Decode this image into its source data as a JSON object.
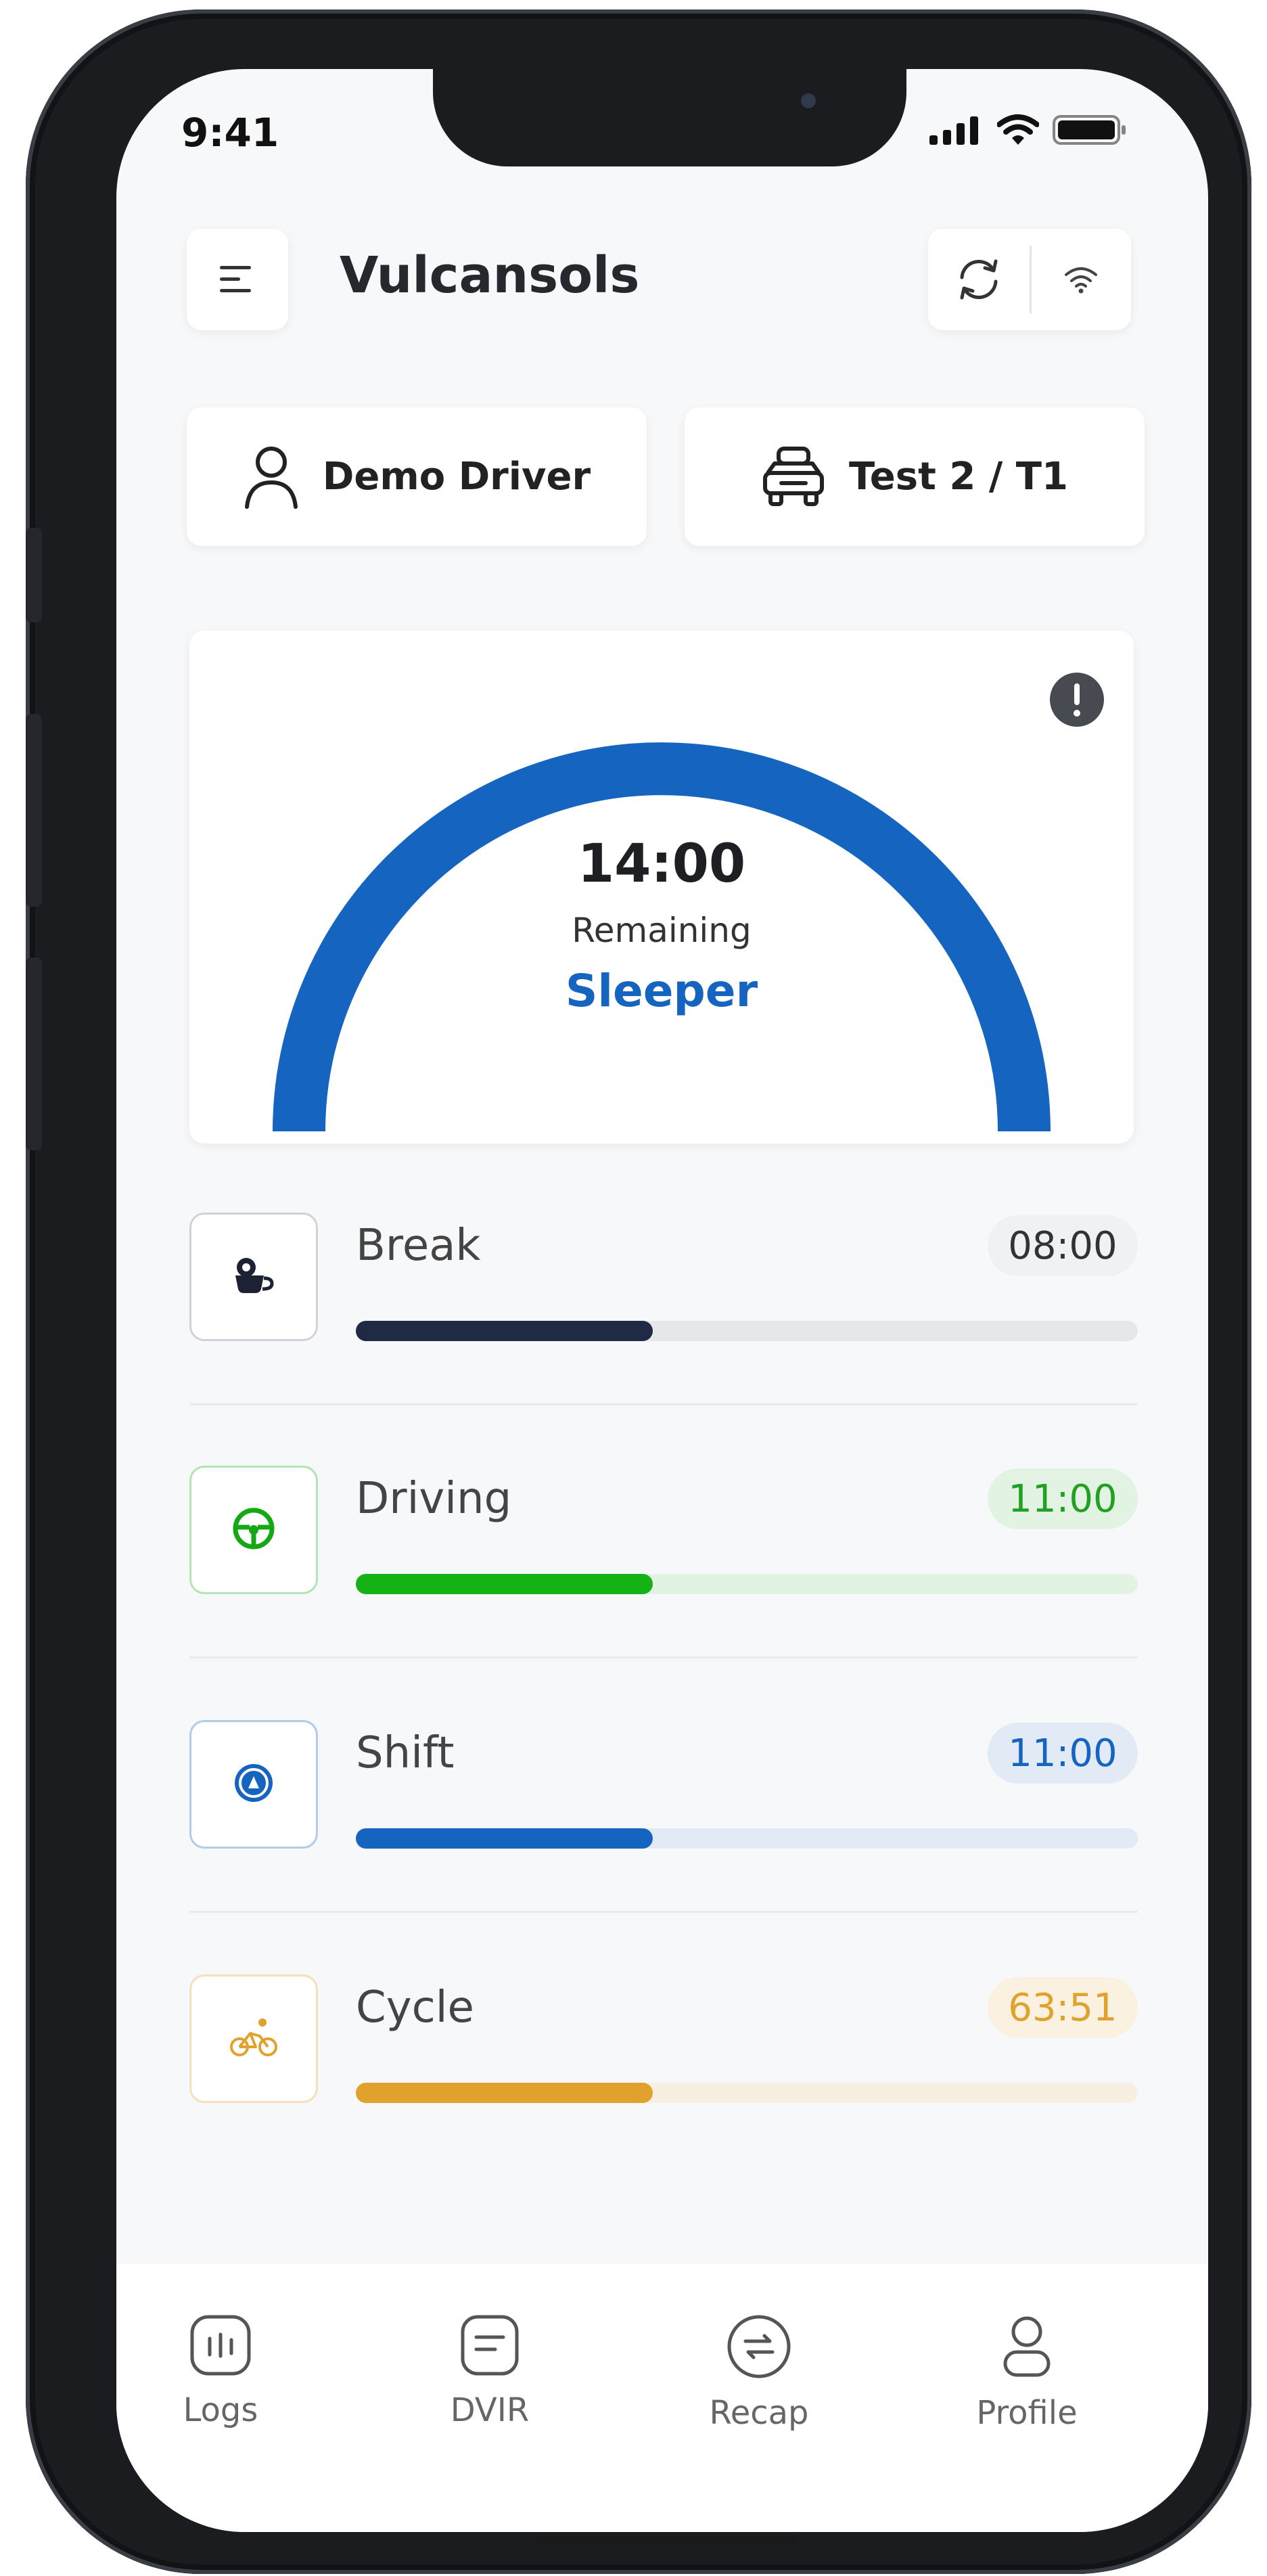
{
  "status_bar": {
    "time": "9:41"
  },
  "header": {
    "title": "Vulcansols"
  },
  "driver": {
    "name": "Demo Driver"
  },
  "vehicle": {
    "label": "Test 2 / T1"
  },
  "gauge": {
    "time": "14:00",
    "label": "Remaining",
    "status": "Sleeper",
    "arc_color": "#1565c0",
    "fill_fraction": 1.0
  },
  "timers": [
    {
      "name": "Break",
      "value": "08:00",
      "progress": 0.38,
      "color": "#1f2a44",
      "track": "#e6e7e9",
      "pill_bg": "#f0f1f2",
      "pill_fg": "#333333",
      "icon": "coffee-icon"
    },
    {
      "name": "Driving",
      "value": "11:00",
      "progress": 0.38,
      "color": "#14b214",
      "track": "#e3f3e3",
      "pill_bg": "#e3f3e3",
      "pill_fg": "#22a022",
      "icon": "steering-wheel-icon"
    },
    {
      "name": "Shift",
      "value": "11:00",
      "progress": 0.38,
      "color": "#1565c0",
      "track": "#e2ebf5",
      "pill_bg": "#e2ebf5",
      "pill_fg": "#1565c0",
      "icon": "shift-clock-icon"
    },
    {
      "name": "Cycle",
      "value": "63:51",
      "progress": 0.38,
      "color": "#e0a22c",
      "track": "#f7efe2",
      "pill_bg": "#fbf1e0",
      "pill_fg": "#e0a22c",
      "icon": "cyclist-icon"
    }
  ],
  "tabs": [
    {
      "label": "Logs",
      "icon": "logs-icon"
    },
    {
      "label": "DVIR",
      "icon": "dvir-icon"
    },
    {
      "label": "Recap",
      "icon": "recap-icon"
    },
    {
      "label": "Profile",
      "icon": "profile-icon"
    }
  ]
}
